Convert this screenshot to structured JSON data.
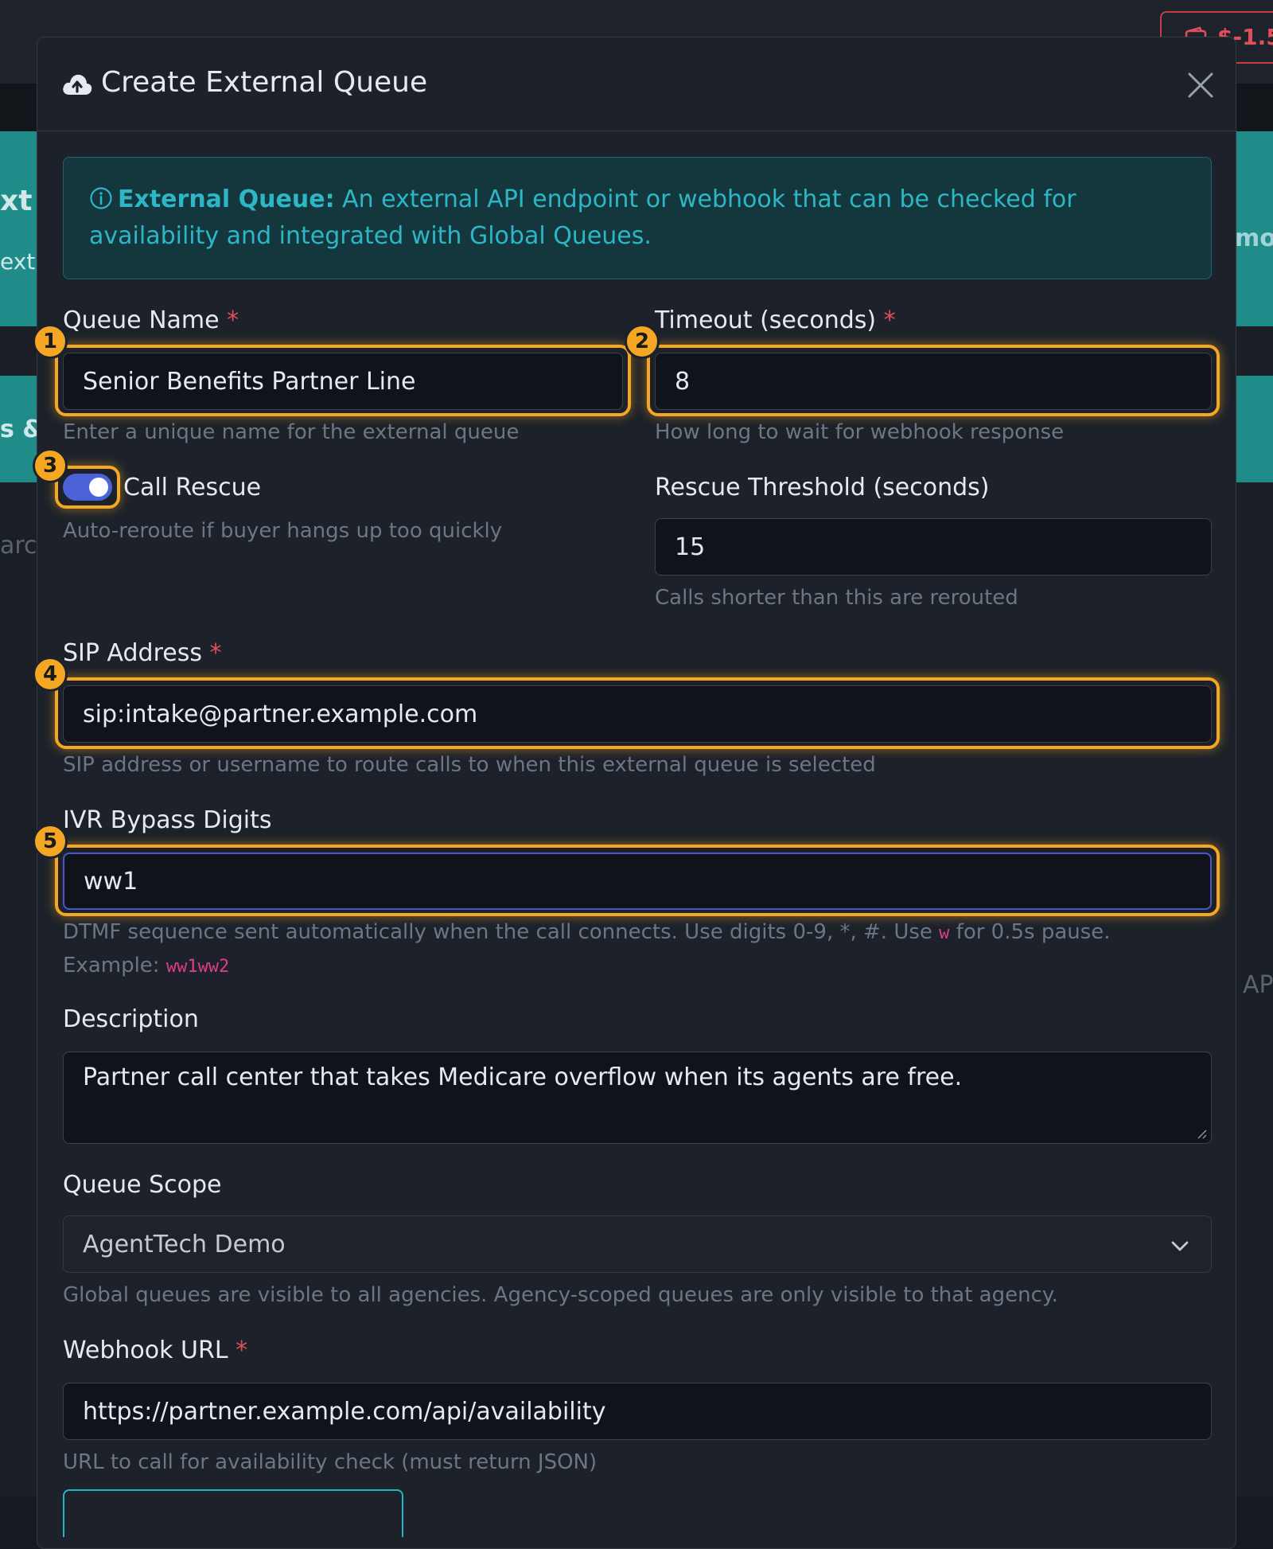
{
  "background": {
    "badge_text": "$-1.5",
    "frag_left_title": "xt",
    "frag_left_sub": "ext",
    "frag_left_and": "s &",
    "frag_left_search": "arc",
    "frag_right_demo": "mo",
    "frag_right_api": "AP"
  },
  "modal": {
    "title": "Create External Queue",
    "close_label": "×"
  },
  "info": {
    "strong": "External Queue:",
    "text": " An external API endpoint or webhook that can be checked for availability and integrated with Global Queues."
  },
  "form": {
    "queue_name": {
      "label": "Queue Name",
      "required": "*",
      "value": "Senior Benefits Partner Line",
      "help": "Enter a unique name for the external queue",
      "marker": "1"
    },
    "timeout": {
      "label": "Timeout (seconds)",
      "required": "*",
      "value": "8",
      "help": "How long to wait for webhook response",
      "marker": "2"
    },
    "call_rescue": {
      "label": "Call Rescue",
      "help": "Auto-reroute if buyer hangs up too quickly",
      "marker": "3",
      "checked": true
    },
    "rescue_threshold": {
      "label": "Rescue Threshold (seconds)",
      "value": "15",
      "help": "Calls shorter than this are rerouted"
    },
    "sip_address": {
      "label": "SIP Address",
      "required": "*",
      "value": "sip:intake@partner.example.com",
      "help": "SIP address or username to route calls to when this external queue is selected",
      "marker": "4"
    },
    "ivr_bypass": {
      "label": "IVR Bypass Digits",
      "value": "ww1",
      "help_a": "DTMF sequence sent automatically when the call connects. Use digits 0-9, *, #. Use ",
      "help_code": "w",
      "help_b": " for 0.5s pause.",
      "help_example": "Example: ",
      "help_example_code": "ww1ww2",
      "marker": "5"
    },
    "description": {
      "label": "Description",
      "value": "Partner call center that takes Medicare overflow when its agents are free."
    },
    "queue_scope": {
      "label": "Queue Scope",
      "value": "AgentTech Demo",
      "help": "Global queues are visible to all agencies. Agency-scoped queues are only visible to that agency."
    },
    "webhook_url": {
      "label": "Webhook URL",
      "required": "*",
      "value": "https://partner.example.com/api/availability",
      "help": "URL to call for availability check (must return JSON)"
    }
  },
  "colors": {
    "accent": "#f5a623",
    "info_text": "#2cb6c6",
    "required": "#e0505a",
    "toggle": "#4b62d8"
  }
}
